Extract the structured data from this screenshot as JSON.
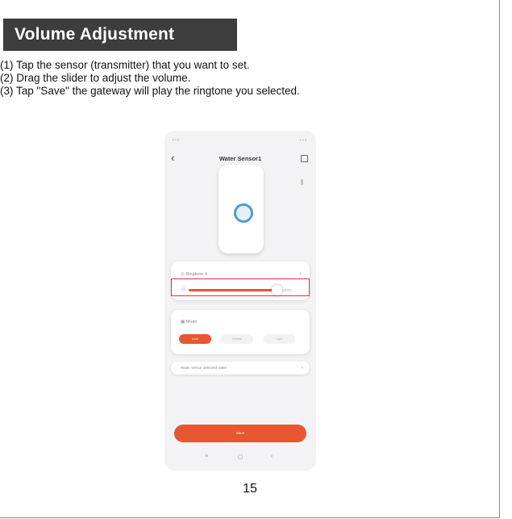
{
  "header": {
    "title": "Volume Adjustment"
  },
  "steps": [
    "(1) Tap the sensor (transmitter) that you want to set.",
    "(2) Drag the slider to adjust the volume.",
    "(3) Tap \"Save\" the gateway will play the ringtone you selected."
  ],
  "phone": {
    "screen_title": "Water Sensor1",
    "ringtone_label": "Ringtone 4",
    "volume_fraction": 0.85,
    "mode_label": "Mode",
    "modes": [
      "Loud",
      "Normal",
      "Light"
    ],
    "active_mode_index": 0,
    "message": "Water sensor detected water",
    "save_label": "Save"
  },
  "footer": {
    "page_number": "15"
  },
  "colors": {
    "accent": "#e8572f",
    "highlight": "#e23232",
    "banner": "#3d3d3d",
    "device_ring": "#4d9bd8"
  }
}
